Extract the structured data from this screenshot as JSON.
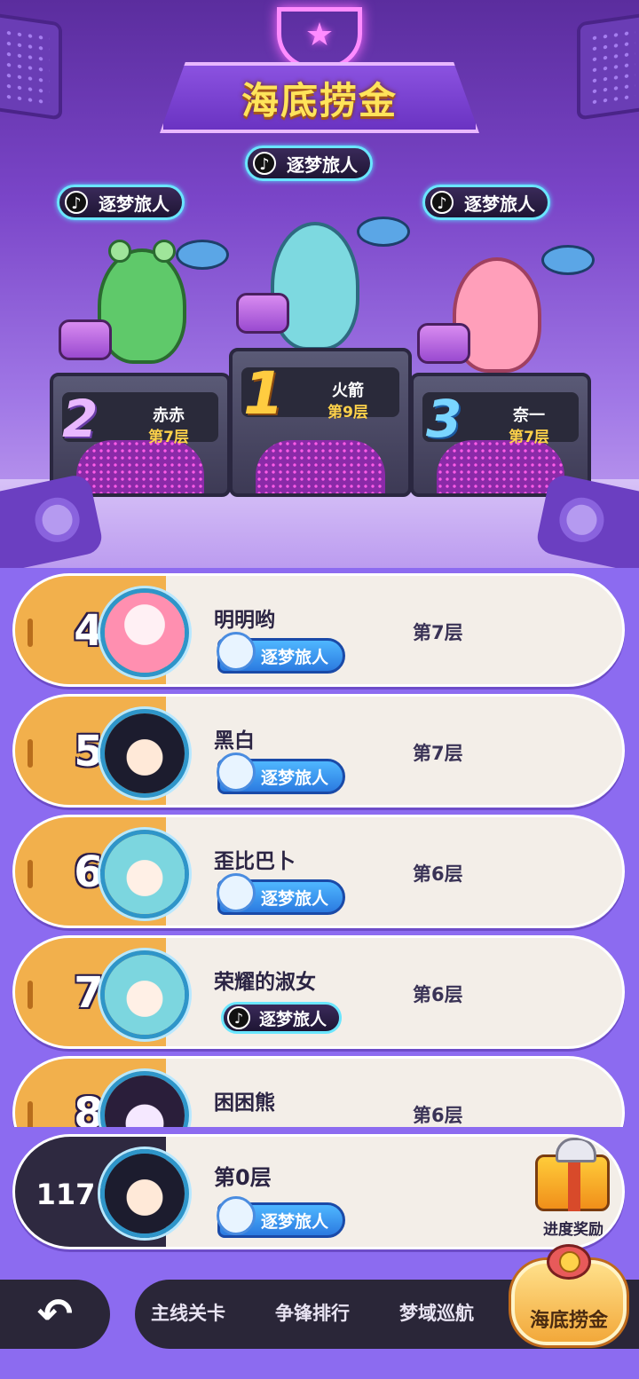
{
  "header": {
    "title": "海底捞金"
  },
  "podium": {
    "tag_label": "逐梦旅人",
    "first": {
      "rank": "1",
      "name": "火箭",
      "floor": "第9层"
    },
    "second": {
      "rank": "2",
      "name": "赤赤",
      "floor": "第7层"
    },
    "third": {
      "rank": "3",
      "name": "奈一",
      "floor": "第7层"
    }
  },
  "list": {
    "rows": [
      {
        "rank": "4",
        "name": "明明哟",
        "floor": "第7层",
        "badge": "逐梦旅人"
      },
      {
        "rank": "5",
        "name": "黑白",
        "floor": "第7层",
        "badge": "逐梦旅人"
      },
      {
        "rank": "6",
        "name": "歪比巴卜",
        "floor": "第6层",
        "badge": "逐梦旅人"
      },
      {
        "rank": "7",
        "name": "荣耀的淑女",
        "floor": "第6层",
        "badge": "逐梦旅人"
      },
      {
        "rank": "8",
        "name": "困困熊",
        "floor": "第6层",
        "badge": ""
      }
    ]
  },
  "my_rank": {
    "rank": "117",
    "floor": "第0层",
    "badge": "逐梦旅人",
    "reward_label": "进度奖励"
  },
  "nav": {
    "back_icon": "↶",
    "tabs": [
      "主线关卡",
      "争锋排行",
      "梦域巡航"
    ],
    "active_tab": "海底捞金"
  },
  "colors": {
    "gold": "#ffe45a",
    "rank_cap": "#f2b04c",
    "badge_blue": "#2b7ae0",
    "background": "#8c6bf0"
  }
}
